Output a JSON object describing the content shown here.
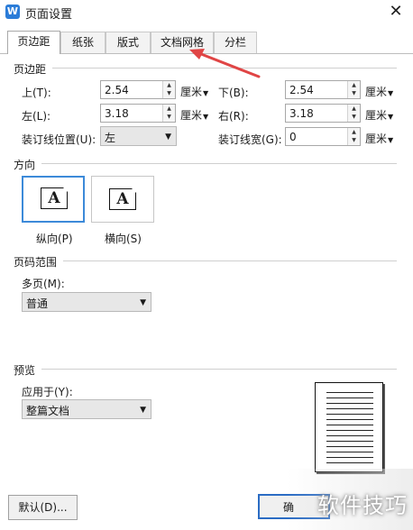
{
  "window": {
    "title": "页面设置",
    "app_icon_letter": "W",
    "close_glyph": "✕"
  },
  "tabs": [
    {
      "label": "页边距",
      "active": true
    },
    {
      "label": "纸张",
      "active": false
    },
    {
      "label": "版式",
      "active": false
    },
    {
      "label": "文档网格",
      "active": false
    },
    {
      "label": "分栏",
      "active": false
    }
  ],
  "margins": {
    "section_title": "页边距",
    "top": {
      "label": "上(T):",
      "value": "2.54",
      "unit": "厘米"
    },
    "bottom": {
      "label": "下(B):",
      "value": "2.54",
      "unit": "厘米"
    },
    "left": {
      "label": "左(L):",
      "value": "3.18",
      "unit": "厘米"
    },
    "right": {
      "label": "右(R):",
      "value": "3.18",
      "unit": "厘米"
    },
    "gutter_position": {
      "label": "装订线位置(U):",
      "value": "左"
    },
    "gutter_width": {
      "label": "装订线宽(G):",
      "value": "0",
      "unit": "厘米"
    }
  },
  "orientation": {
    "section_title": "方向",
    "portrait": {
      "label": "纵向(P)",
      "glyph": "A",
      "selected": true
    },
    "landscape": {
      "label": "横向(S)",
      "glyph": "A",
      "selected": false
    }
  },
  "page_range": {
    "section_title": "页码范围",
    "multiple_pages_label": "多页(M):",
    "multiple_pages_value": "普通"
  },
  "preview": {
    "section_title": "预览",
    "apply_to_label": "应用于(Y):",
    "apply_to_value": "整篇文档"
  },
  "buttons": {
    "default": "默认(D)...",
    "ok_partial": "确"
  },
  "watermark": "软件技巧",
  "colors": {
    "accent": "#3c8ad9",
    "annotation_arrow": "#e04545"
  }
}
